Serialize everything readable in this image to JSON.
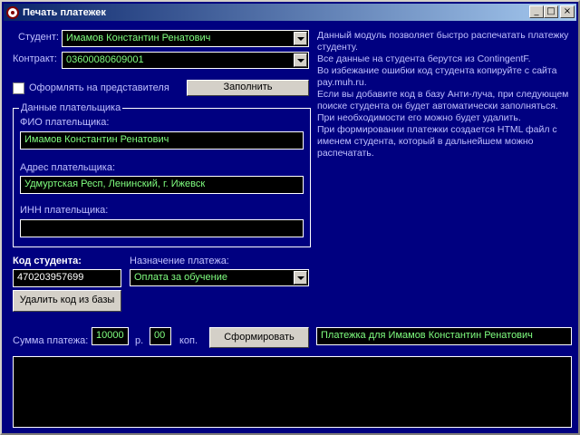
{
  "window": {
    "title": "Печать платежек",
    "minimize": "_",
    "maximize": "□",
    "close": "×"
  },
  "form": {
    "student_label": "Студент:",
    "student_value": "Имамов Константин Ренатович",
    "contract_label": "Контракт:",
    "contract_value": "03600080609001",
    "representative_label": "Оформлять на представителя",
    "fill_button": "Заполнить",
    "payer_group_title": "Данные плательщика",
    "payer_name_label": "ФИО плательщика:",
    "payer_name_value": "Имамов Константин Ренатович",
    "payer_address_label": "Адрес плательщика:",
    "payer_address_value": "Удмуртская Респ, Ленинский, г. Ижевск",
    "payer_inn_label": "ИНН плательщика:",
    "payer_inn_value": "",
    "student_code_label": "Код студента:",
    "student_code_value": "470203957699",
    "delete_code_button": "Удалить код из базы",
    "purpose_label": "Назначение платежа:",
    "purpose_value": "Оплата за обучение",
    "amount_label": "Сумма платежа:",
    "amount_rub": "10000",
    "rub_label": "р.",
    "amount_kop": "00",
    "kop_label": "коп.",
    "generate_button": "Сформировать",
    "result_text": "Платежка для Имамов Константин Ренатович"
  },
  "description": [
    "Данный модуль позволяет быстро распечатать платежку студенту.",
    "Все данные на студента берутся из ContingentF.",
    "Во избежание ошибки код студента копируйте с сайта pay.muh.ru.",
    "Если вы добавите код в базу Анти-луча, при следующем поиске студента он будет автоматически заполняться. При необходимости его можно будет удалить.",
    "При формировании платежки создается HTML файл с именем студента,  который в дальнейшем можно распечатать."
  ]
}
